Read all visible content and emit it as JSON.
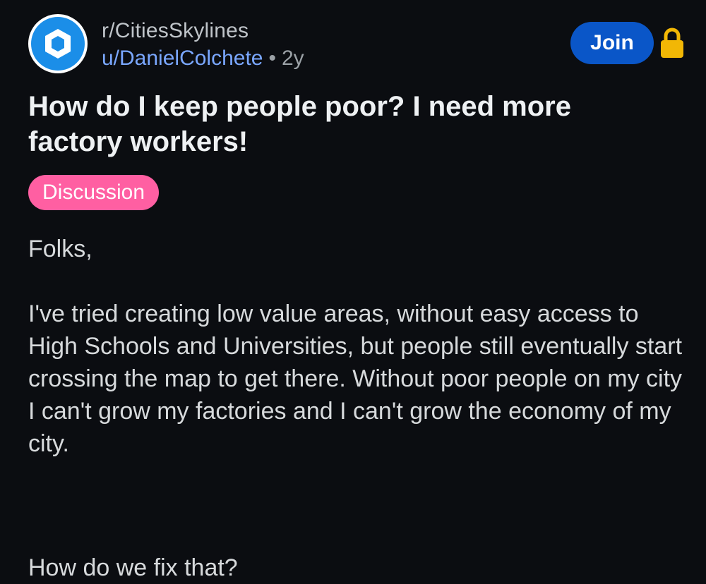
{
  "post": {
    "subreddit": "r/CitiesSkylines",
    "username": "u/DanielColchete",
    "separator": "•",
    "age": "2y",
    "join_label": "Join",
    "title": "How do I keep people poor? I need more factory workers!",
    "flair": "Discussion",
    "body": [
      "Folks,",
      "I've tried creating low value areas, without easy access to High Schools and Universities, but people still eventually start crossing the map to get there. Without poor people on my city I can't grow my factories and I can't grow the economy of my city.",
      "How do we fix that?"
    ]
  },
  "colors": {
    "background": "#0b0d11",
    "join_button": "#0a56c8",
    "flair": "#ff5fa2",
    "username": "#7aa7ff",
    "lock": "#f2b705",
    "avatar": "#1b8ee8"
  },
  "icons": {
    "avatar": "subreddit-logo-icon",
    "lock": "lock-icon"
  }
}
